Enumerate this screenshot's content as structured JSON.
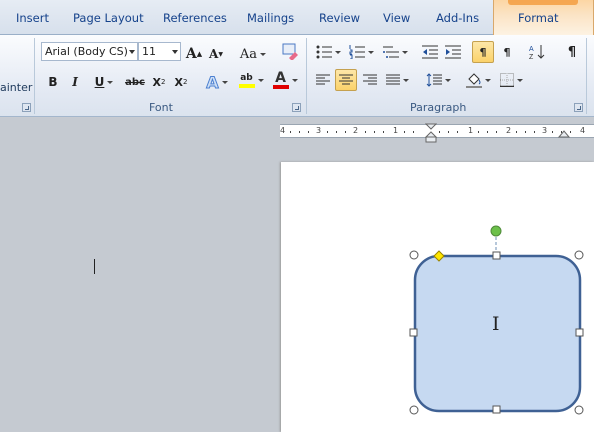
{
  "tabs": [
    "Insert",
    "Page Layout",
    "References",
    "Mailings",
    "Review",
    "View",
    "Add-Ins"
  ],
  "contextual_tab": {
    "label": "Format"
  },
  "clipboard": {
    "format_painter_label": "ainter"
  },
  "font_group": {
    "label": "Font",
    "font_name": "Arial (Body CS)",
    "font_size": "11",
    "case_label": "Aa",
    "bold": "B",
    "italic": "I",
    "underline": "U",
    "strikethrough": "abc",
    "subscript": "X",
    "subscript_mark": "2",
    "superscript": "X",
    "superscript_mark": "2",
    "text_effects": "A",
    "highlight": "ab",
    "font_color": "A",
    "grow": "A",
    "shrink": "A"
  },
  "paragraph_group": {
    "label": "Paragraph",
    "pilcrow": "¶"
  },
  "ruler": {
    "numbers": [
      "4",
      "3",
      "2",
      "1",
      "1",
      "2",
      "3",
      "4"
    ]
  },
  "shape": {
    "text_cursor": "I"
  },
  "colors": {
    "shape_fill": "#c6d9f1",
    "shape_stroke": "#3f6194",
    "rotation_handle": "#6cc04a",
    "adjust_handle": "#ffe600",
    "active_button": "#fbd26a"
  }
}
